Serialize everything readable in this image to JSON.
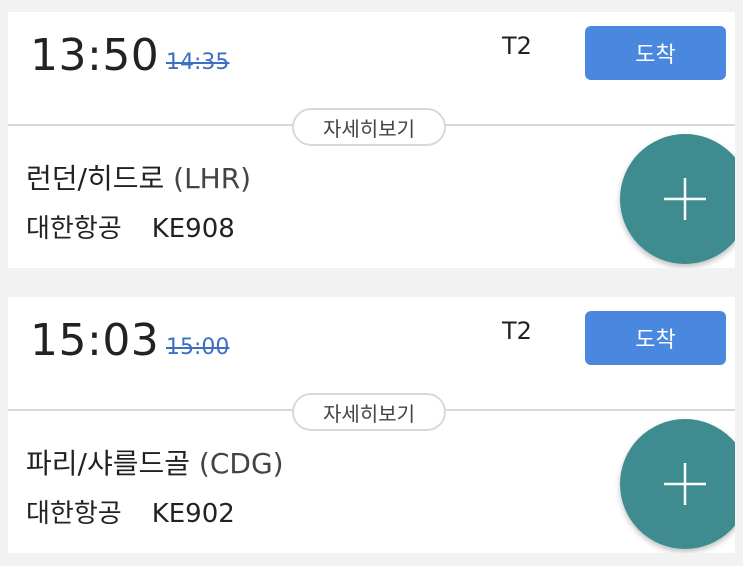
{
  "flights": [
    {
      "time": "13:50",
      "scheduled_time": "14:35",
      "terminal": "T2",
      "status_label": "도착",
      "details_label": "자세히보기",
      "destination": "런던/히드로",
      "airport_code": "(LHR)",
      "airline": "대한항공",
      "flight_number": "KE908",
      "add_icon": "plus-icon"
    },
    {
      "time": "15:03",
      "scheduled_time": "15:00",
      "terminal": "T2",
      "status_label": "도착",
      "details_label": "자세히보기",
      "destination": "파리/샤를드골",
      "airport_code": "(CDG)",
      "airline": "대한항공",
      "flight_number": "KE902",
      "add_icon": "plus-icon"
    }
  ],
  "colors": {
    "status_button": "#4a88e0",
    "fab": "#3e8c90",
    "strikethrough_time": "#3d6fc4",
    "divider": "#d9d9d9"
  }
}
